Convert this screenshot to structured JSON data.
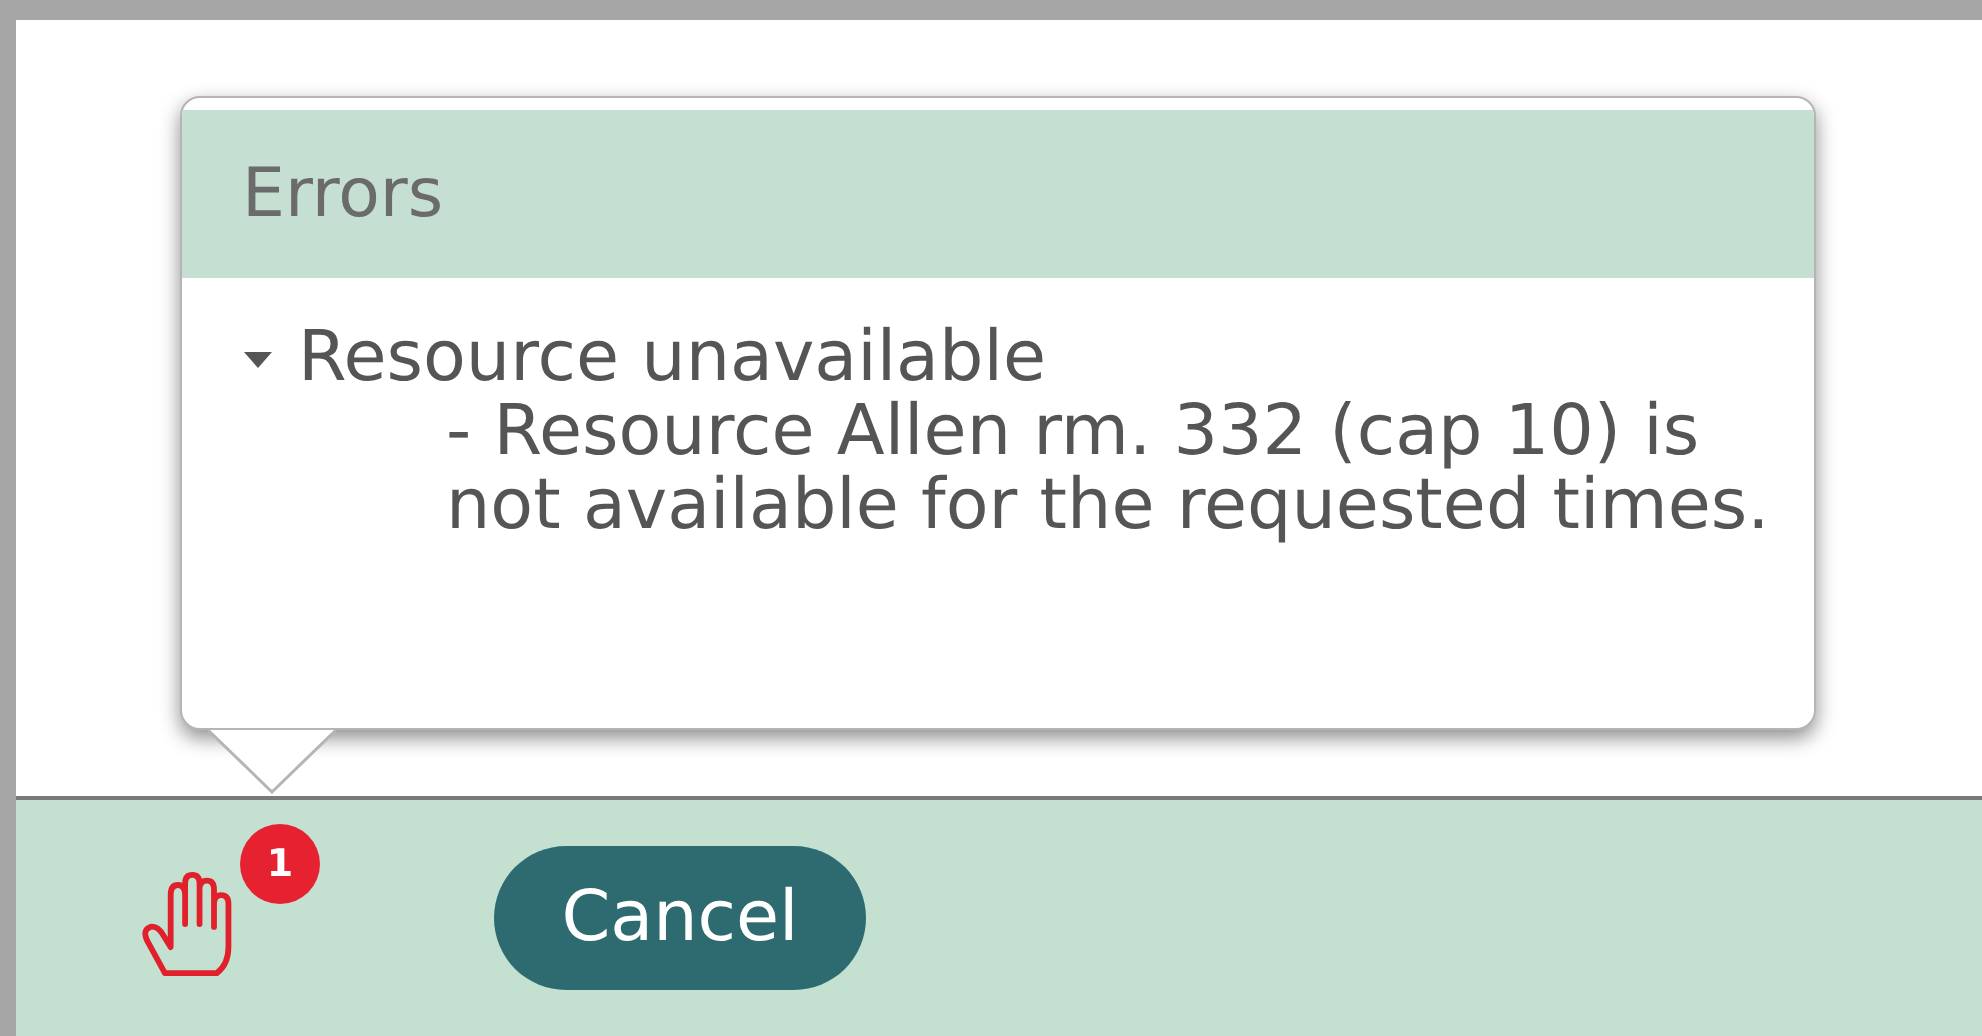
{
  "popover": {
    "title": "Errors",
    "groups": [
      {
        "label": "Resource unavailable",
        "expanded": true,
        "messages": [
          "- Resource Allen rm. 332 (cap 10) is not available for the requested times."
        ]
      }
    ]
  },
  "footer": {
    "error_badge": "1",
    "buttons": [
      "Cancel"
    ]
  }
}
